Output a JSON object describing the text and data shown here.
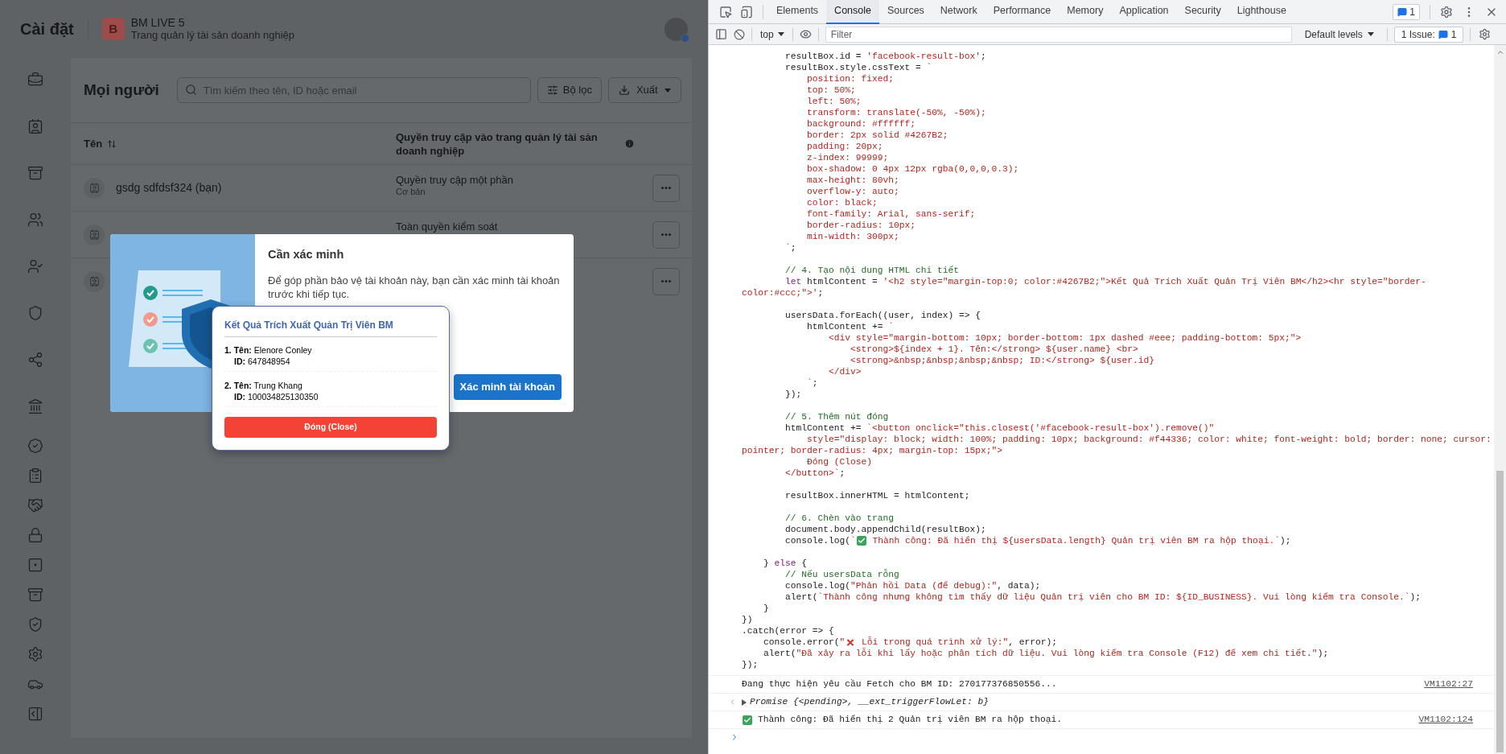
{
  "page": {
    "title": "Cài đặt",
    "business": {
      "logo_letter": "B",
      "name": "BM LIVE 5",
      "subtitle": "Trang quản lý tài sản doanh nghiệp"
    }
  },
  "people": {
    "title": "Mọi người",
    "search": {
      "placeholder": "Tìm kiếm theo tên, ID hoặc email"
    },
    "filter_button": "Bộ lọc",
    "export_button": "Xuất",
    "columns": [
      "Tên",
      "Quyền truy cập vào trang quản lý tài sản doanh nghiệp"
    ],
    "rows": [
      {
        "name": "gsdg sdfdsf324 (bạn)",
        "access": "Quyền truy cập một phần",
        "role": "Cơ bản"
      },
      {
        "access": "Toàn quyền kiểm soát"
      },
      {}
    ]
  },
  "verify_dialog": {
    "title": "Cần xác minh",
    "body": "Để góp phần bảo vệ tài khoản này, bạn cần xác minh tài khoản trước khi tiếp tục.",
    "button": "Xác minh tài khoản"
  },
  "result_box": {
    "title": "Kết Quả Trích Xuất Quản Trị Viên BM",
    "admins": [
      {
        "name_line": "**1. Tên:** Elenore Conley",
        "id_line": "**ID:** 647848954"
      },
      {
        "name_line": "**2. Tên:** Trung Khang",
        "id_line": "**ID:** 100034825130350"
      }
    ],
    "close_button": "Đóng (Close)"
  },
  "devtools": {
    "tabs": [
      {
        "label": "Elements",
        "selected": false
      },
      {
        "label": "Console",
        "selected": true
      },
      {
        "label": "Sources",
        "selected": false
      },
      {
        "label": "Network",
        "selected": false
      },
      {
        "label": "Performance",
        "selected": false
      },
      {
        "label": "Memory",
        "selected": false
      },
      {
        "label": "Application",
        "selected": false
      },
      {
        "label": "Security",
        "selected": false
      },
      {
        "label": "Lighthouse",
        "selected": false
      }
    ],
    "messages_badge": "1",
    "context": "top",
    "filter": {
      "placeholder": "Filter"
    },
    "levels": "Default levels",
    "issues": {
      "label": "1 Issue:",
      "count": "1"
    },
    "code_lines": [
      {
        "kind": "code",
        "parts": [
          {
            "kind": "plain",
            "text": "        resultBox.id = "
          },
          {
            "kind": "string",
            "text": "'facebook-result-box'"
          },
          {
            "kind": "plain",
            "text": ";"
          }
        ]
      },
      {
        "kind": "code",
        "parts": [
          {
            "kind": "plain",
            "text": "        resultBox.style.cssText = "
          },
          {
            "kind": "string",
            "text": "`"
          }
        ]
      },
      {
        "kind": "code",
        "parts": [
          {
            "kind": "string",
            "text": "            position: fixed;"
          }
        ]
      },
      {
        "kind": "code",
        "parts": [
          {
            "kind": "string",
            "text": "            top: 50%;"
          }
        ]
      },
      {
        "kind": "code",
        "parts": [
          {
            "kind": "string",
            "text": "            left: 50%;"
          }
        ]
      },
      {
        "kind": "code",
        "parts": [
          {
            "kind": "string",
            "text": "            transform: translate(-50%, -50%);"
          }
        ]
      },
      {
        "kind": "code",
        "parts": [
          {
            "kind": "string",
            "text": "            background: #ffffff;"
          }
        ]
      },
      {
        "kind": "code",
        "parts": [
          {
            "kind": "string",
            "text": "            border: 2px solid #4267B2;"
          }
        ]
      },
      {
        "kind": "code",
        "parts": [
          {
            "kind": "string",
            "text": "            padding: 20px;"
          }
        ]
      },
      {
        "kind": "code",
        "parts": [
          {
            "kind": "string",
            "text": "            z-index: 99999;"
          }
        ]
      },
      {
        "kind": "code",
        "parts": [
          {
            "kind": "string",
            "text": "            box-shadow: 0 4px 12px rgba(0,0,0,0.3);"
          }
        ]
      },
      {
        "kind": "code",
        "parts": [
          {
            "kind": "string",
            "text": "            max-height: 80vh;"
          }
        ]
      },
      {
        "kind": "code",
        "parts": [
          {
            "kind": "string",
            "text": "            overflow-y: auto;"
          }
        ]
      },
      {
        "kind": "code",
        "parts": [
          {
            "kind": "string",
            "text": "            color: black;"
          }
        ]
      },
      {
        "kind": "code",
        "parts": [
          {
            "kind": "string",
            "text": "            font-family: Arial, sans-serif;"
          }
        ]
      },
      {
        "kind": "code",
        "parts": [
          {
            "kind": "string",
            "text": "            border-radius: 10px;"
          }
        ]
      },
      {
        "kind": "code",
        "parts": [
          {
            "kind": "string",
            "text": "            min-width: 300px;"
          }
        ]
      },
      {
        "kind": "code",
        "parts": [
          {
            "kind": "string",
            "text": "        `"
          },
          {
            "kind": "plain",
            "text": ";"
          }
        ]
      },
      {
        "kind": "blank"
      },
      {
        "kind": "code",
        "parts": [
          {
            "kind": "comment",
            "text": "        // 4. Tạo nội dung HTML chi tiết"
          }
        ]
      },
      {
        "kind": "code",
        "parts": [
          {
            "kind": "keyword",
            "text": "        let"
          },
          {
            "kind": "plain",
            "text": " htmlContent = "
          },
          {
            "kind": "string",
            "text": "'<h2 style=\"margin-top:0; color:#4267B2;\">Kết Quả Trích Xuất Quản Trị Viên BM</h2><hr style=\"border-"
          }
        ]
      },
      {
        "kind": "code",
        "parts": [
          {
            "kind": "string",
            "text": "color:#ccc;\">'"
          },
          {
            "kind": "plain",
            "text": ";"
          }
        ]
      },
      {
        "kind": "blank"
      },
      {
        "kind": "code",
        "parts": [
          {
            "kind": "plain",
            "text": "        usersData.forEach((user, index) => {"
          }
        ]
      },
      {
        "kind": "code",
        "parts": [
          {
            "kind": "plain",
            "text": "            htmlContent += "
          },
          {
            "kind": "string",
            "text": "`"
          }
        ]
      },
      {
        "kind": "code",
        "parts": [
          {
            "kind": "string",
            "text": "                <div style=\"margin-bottom: 10px; border-bottom: 1px dashed #eee; padding-bottom: 5px;\">"
          }
        ]
      },
      {
        "kind": "code",
        "parts": [
          {
            "kind": "string",
            "text": "                    <strong>${index + 1}. Tên:</strong> ${user.name} <br>"
          }
        ]
      },
      {
        "kind": "code",
        "parts": [
          {
            "kind": "string",
            "text": "                    <strong>&nbsp;&nbsp;&nbsp;&nbsp; ID:</strong> ${user.id}"
          }
        ]
      },
      {
        "kind": "code",
        "parts": [
          {
            "kind": "string",
            "text": "                </div>"
          }
        ]
      },
      {
        "kind": "code",
        "parts": [
          {
            "kind": "string",
            "text": "            `"
          },
          {
            "kind": "plain",
            "text": ";"
          }
        ]
      },
      {
        "kind": "code",
        "parts": [
          {
            "kind": "plain",
            "text": "        });"
          }
        ]
      },
      {
        "kind": "blank"
      },
      {
        "kind": "code",
        "parts": [
          {
            "kind": "comment",
            "text": "        // 5. Thêm nút đóng"
          }
        ]
      },
      {
        "kind": "code",
        "parts": [
          {
            "kind": "plain",
            "text": "        htmlContent += "
          },
          {
            "kind": "string",
            "text": "`<button onclick=\"this.closest('#facebook-result-box').remove()\""
          }
        ]
      },
      {
        "kind": "code",
        "parts": [
          {
            "kind": "string",
            "text": "            style=\"display: block; width: 100%; padding: 10px; background: #f44336; color: white; font-weight: bold; border: none; cursor:"
          }
        ]
      },
      {
        "kind": "code",
        "parts": [
          {
            "kind": "string",
            "text": "pointer; border-radius: 4px; margin-top: 15px;\">"
          }
        ]
      },
      {
        "kind": "code",
        "parts": [
          {
            "kind": "string",
            "text": "            Đóng (Close)"
          }
        ]
      },
      {
        "kind": "code",
        "parts": [
          {
            "kind": "string",
            "text": "        </button>`"
          },
          {
            "kind": "plain",
            "text": ";"
          }
        ]
      },
      {
        "kind": "blank"
      },
      {
        "kind": "code",
        "parts": [
          {
            "kind": "plain",
            "text": "        resultBox.innerHTML = htmlContent;"
          }
        ]
      },
      {
        "kind": "blank"
      },
      {
        "kind": "code",
        "parts": [
          {
            "kind": "comment",
            "text": "        // 6. Chèn vào trang"
          }
        ]
      },
      {
        "kind": "code",
        "parts": [
          {
            "kind": "plain",
            "text": "        document.body.appendChild(resultBox);"
          }
        ]
      },
      {
        "kind": "code",
        "parts": [
          {
            "kind": "plain",
            "text": "        console.log("
          },
          {
            "kind": "string",
            "text": "`"
          },
          {
            "kind": "emoji_check"
          },
          {
            "kind": "string",
            "text": " Thành công: Đã hiển thị ${usersData.length} Quản trị viên BM ra hộp thoại.`"
          },
          {
            "kind": "plain",
            "text": ");"
          }
        ]
      },
      {
        "kind": "blank"
      },
      {
        "kind": "code",
        "parts": [
          {
            "kind": "plain",
            "text": "    } "
          },
          {
            "kind": "keyword",
            "text": "else"
          },
          {
            "kind": "plain",
            "text": " {"
          }
        ]
      },
      {
        "kind": "code",
        "parts": [
          {
            "kind": "comment",
            "text": "        // Nếu usersData rỗng"
          }
        ]
      },
      {
        "kind": "code",
        "parts": [
          {
            "kind": "plain",
            "text": "        console.log("
          },
          {
            "kind": "string",
            "text": "\"Phản hồi Data (để debug):\""
          },
          {
            "kind": "plain",
            "text": ", data);"
          }
        ]
      },
      {
        "kind": "code",
        "parts": [
          {
            "kind": "plain",
            "text": "        alert("
          },
          {
            "kind": "string",
            "text": "`Thành công nhưng không tìm thấy dữ liệu Quản trị viên cho BM ID: ${ID_BUSINESS}. Vui lòng kiểm tra Console.`"
          },
          {
            "kind": "plain",
            "text": ");"
          }
        ]
      },
      {
        "kind": "code",
        "parts": [
          {
            "kind": "plain",
            "text": "    }"
          }
        ]
      },
      {
        "kind": "code",
        "parts": [
          {
            "kind": "plain",
            "text": "})"
          }
        ]
      },
      {
        "kind": "code",
        "parts": [
          {
            "kind": "plain",
            "text": ".catch(error => {"
          }
        ]
      },
      {
        "kind": "code",
        "parts": [
          {
            "kind": "plain",
            "text": "    console.error("
          },
          {
            "kind": "string",
            "text": "\""
          },
          {
            "kind": "emoji_cross"
          },
          {
            "kind": "string",
            "text": " Lỗi trong quá trình xử lý:\""
          },
          {
            "kind": "plain",
            "text": ", error);"
          }
        ]
      },
      {
        "kind": "code",
        "parts": [
          {
            "kind": "plain",
            "text": "    alert("
          },
          {
            "kind": "string",
            "text": "\"Đã xảy ra lỗi khi lấy hoặc phân tích dữ liệu. Vui lòng kiểm tra Console (F12) để xem chi tiết.\""
          },
          {
            "kind": "plain",
            "text": ");"
          }
        ]
      },
      {
        "kind": "code",
        "parts": [
          {
            "kind": "plain",
            "text": "});"
          }
        ]
      }
    ],
    "messages": [
      {
        "kind": "log",
        "text": "Đang thực hiện yêu cầu Fetch cho BM ID: 270177376850556...",
        "source": "VM1102:27"
      },
      {
        "kind": "result",
        "text": "Promise {<pending>, __ext_triggerFlowLet: b}"
      },
      {
        "kind": "success",
        "text": "Thành công: Đã hiển thị 2 Quản trị viên BM ra hộp thoại.",
        "source": "VM1102:124"
      }
    ]
  }
}
